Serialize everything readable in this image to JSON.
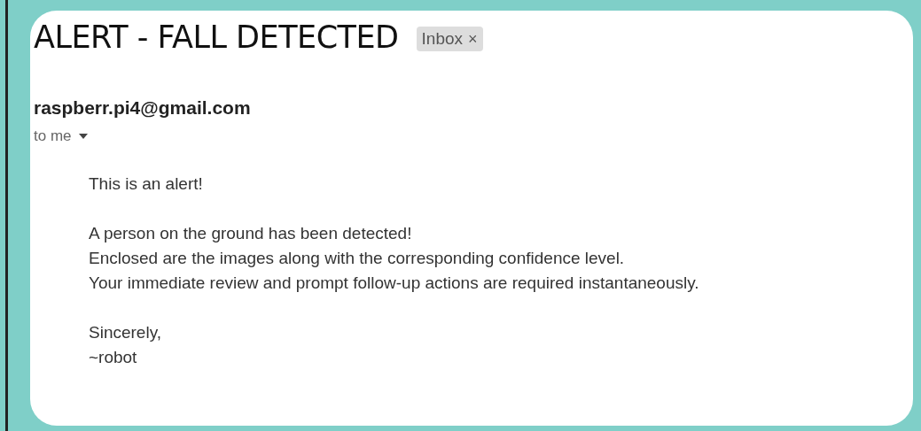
{
  "subject": "ALERT - FALL DETECTED",
  "label": {
    "text": "Inbox",
    "close": "×"
  },
  "sender": "raspberr.pi4@gmail.com",
  "recipient": "to me",
  "body": [
    [
      "This is an alert!"
    ],
    [
      "A person on the ground has been detected!",
      "Enclosed are the images along with the corresponding confidence level.",
      "Your immediate review and prompt follow-up actions are required instantaneously."
    ],
    [
      "Sincerely,",
      "~robot"
    ]
  ]
}
